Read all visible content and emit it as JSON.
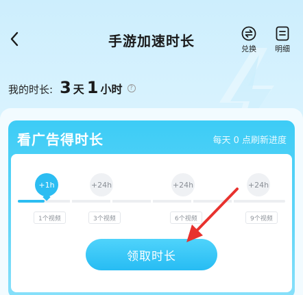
{
  "header": {
    "title": "手游加速时长",
    "back_icon": "chevron-left-icon",
    "actions": [
      {
        "label": "兑换",
        "icon": "exchange-icon"
      },
      {
        "label": "明细",
        "icon": "list-detail-icon"
      }
    ]
  },
  "balance": {
    "label": "我的时长:",
    "days": "3",
    "days_unit": "天",
    "hours": "1",
    "hours_unit": "小时",
    "help_icon": "question-icon",
    "help_glyph": "?"
  },
  "ad_card": {
    "title": "看广告得时长",
    "hint": "每天 0 点刷新进度",
    "progress_fraction": 0.1,
    "steps": [
      {
        "reward": "+1h",
        "videos": "1个视频",
        "done": true
      },
      {
        "reward": "+24h",
        "videos": "3个视频",
        "done": false
      },
      {
        "reward": "+24h",
        "videos": "6个视频",
        "done": false
      },
      {
        "reward": "+24h",
        "videos": "9个视频",
        "done": false
      }
    ],
    "claim_label": "领取时长"
  },
  "colors": {
    "accent": "#2cbdf2",
    "card_top": "#3dccf6",
    "pointer_arrow": "#e8322e"
  }
}
